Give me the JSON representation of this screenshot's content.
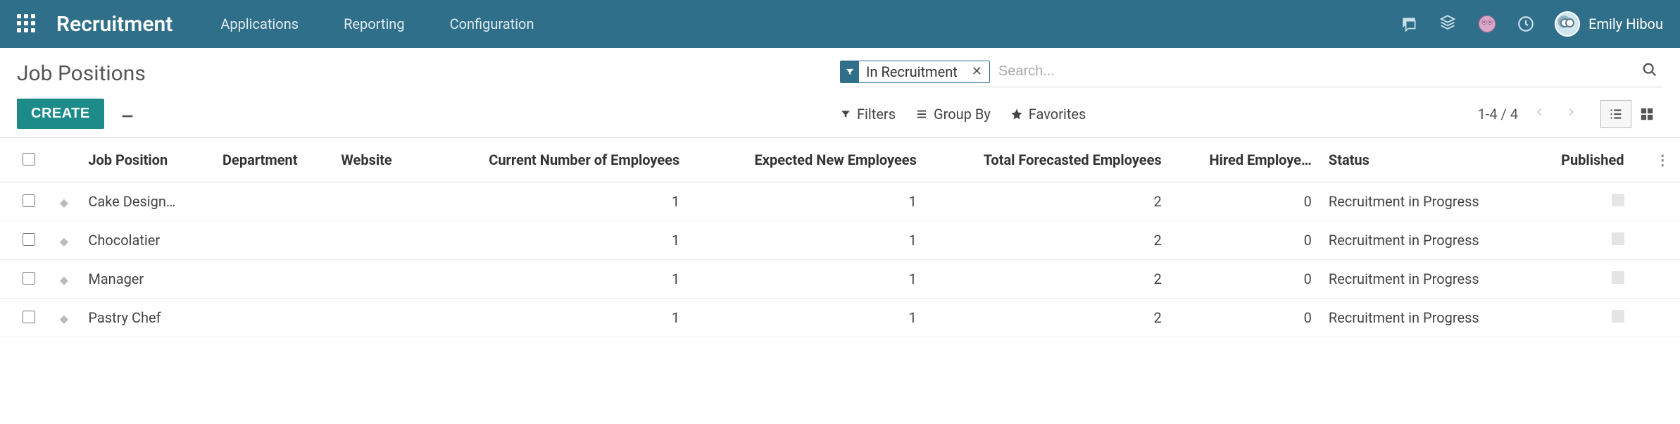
{
  "nav": {
    "brand": "Recruitment",
    "links": [
      "Applications",
      "Reporting",
      "Configuration"
    ],
    "user_name": "Emily Hibou"
  },
  "page": {
    "title": "Job Positions",
    "create_label": "CREATE"
  },
  "search": {
    "facet_label": "In Recruitment",
    "placeholder": "Search..."
  },
  "toolbar": {
    "filters": "Filters",
    "group_by": "Group By",
    "favorites": "Favorites",
    "pager": "1-4 / 4"
  },
  "table": {
    "headers": {
      "job": "Job Position",
      "department": "Department",
      "website": "Website",
      "current": "Current Number of Employees",
      "expected": "Expected New Employees",
      "total": "Total Forecasted Employees",
      "hired": "Hired Employe…",
      "status": "Status",
      "published": "Published"
    },
    "rows": [
      {
        "job": "Cake Design…",
        "department": "",
        "website": "",
        "current": 1,
        "expected": 1,
        "total": 2,
        "hired": 0,
        "status": "Recruitment in Progress"
      },
      {
        "job": "Chocolatier",
        "department": "",
        "website": "",
        "current": 1,
        "expected": 1,
        "total": 2,
        "hired": 0,
        "status": "Recruitment in Progress"
      },
      {
        "job": "Manager",
        "department": "",
        "website": "",
        "current": 1,
        "expected": 1,
        "total": 2,
        "hired": 0,
        "status": "Recruitment in Progress"
      },
      {
        "job": "Pastry Chef",
        "department": "",
        "website": "",
        "current": 1,
        "expected": 1,
        "total": 2,
        "hired": 0,
        "status": "Recruitment in Progress"
      }
    ]
  }
}
